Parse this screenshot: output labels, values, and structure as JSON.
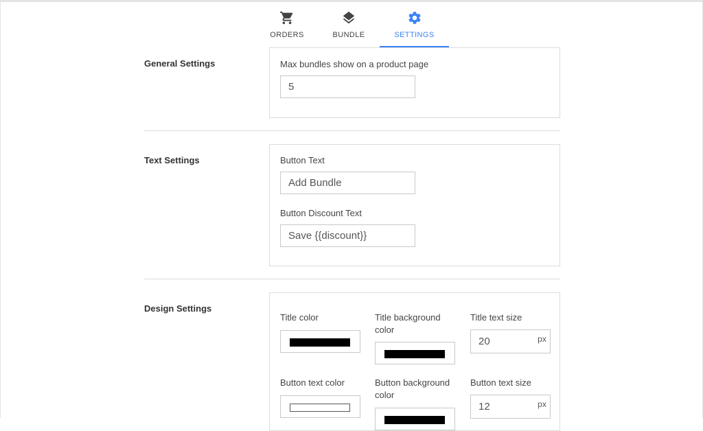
{
  "tabs": [
    {
      "label": "ORDERS",
      "icon": "cart-icon",
      "active": false
    },
    {
      "label": "BUNDLE",
      "icon": "layers-icon",
      "active": false
    },
    {
      "label": "SETTINGS",
      "icon": "gear-icon",
      "active": true
    }
  ],
  "colors": {
    "accent": "#3b82f6",
    "border": "#dcdcdc",
    "swatch_black": "#000000",
    "swatch_white": "#ffffff"
  },
  "general": {
    "title": "General Settings",
    "max_bundles_label": "Max bundles show on a product page",
    "max_bundles_value": "5"
  },
  "text": {
    "title": "Text Settings",
    "button_text_label": "Button Text",
    "button_text_value": "Add Bundle",
    "discount_text_label": "Button Discount Text",
    "discount_text_value": "Save {{discount}}"
  },
  "design": {
    "title": "Design Settings",
    "title_color_label": "Title color",
    "title_bg_color_label": "Title background color",
    "title_text_size_label": "Title text size",
    "title_text_size_value": "20",
    "button_text_color_label": "Button text color",
    "button_bg_color_label": "Button background color",
    "button_text_size_label": "Button text size",
    "button_text_size_value": "12",
    "unit": "px"
  }
}
